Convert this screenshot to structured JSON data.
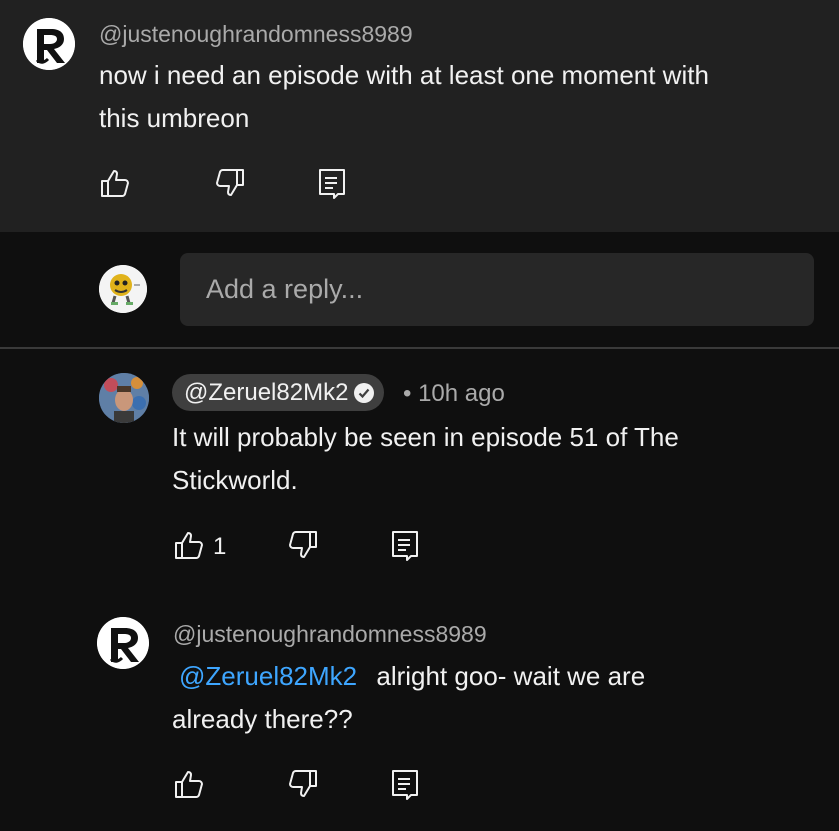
{
  "comment": {
    "handle": "@justenoughrandomness8989",
    "text_line1": "now i need an episode with at least one moment with",
    "text_line2": "this umbreon"
  },
  "reply_box": {
    "placeholder": "Add a reply..."
  },
  "replies": [
    {
      "handle": "@Zeruel82Mk2",
      "time": "10h ago",
      "text_line1": "It will probably be seen in episode 51 of The",
      "text_line2": "Stickworld.",
      "likes": "1"
    },
    {
      "handle": "@justenoughrandomness8989",
      "mention": "@Zeruel82Mk2",
      "text_line1_rest": "alright goo- wait we are",
      "text_line2": "already there??"
    }
  ],
  "icons": {
    "like": "thumbs-up-icon",
    "dislike": "thumbs-down-icon",
    "reply": "reply-comment-icon",
    "verified": "verified-check-icon"
  },
  "colors": {
    "background": "#0f0f0f",
    "top_comment_bg": "#212121",
    "input_bg": "#272727",
    "chip_bg": "#3f3f3f",
    "mention": "#3ea6ff",
    "secondary_text": "#aaaaaa"
  },
  "separator": "•"
}
